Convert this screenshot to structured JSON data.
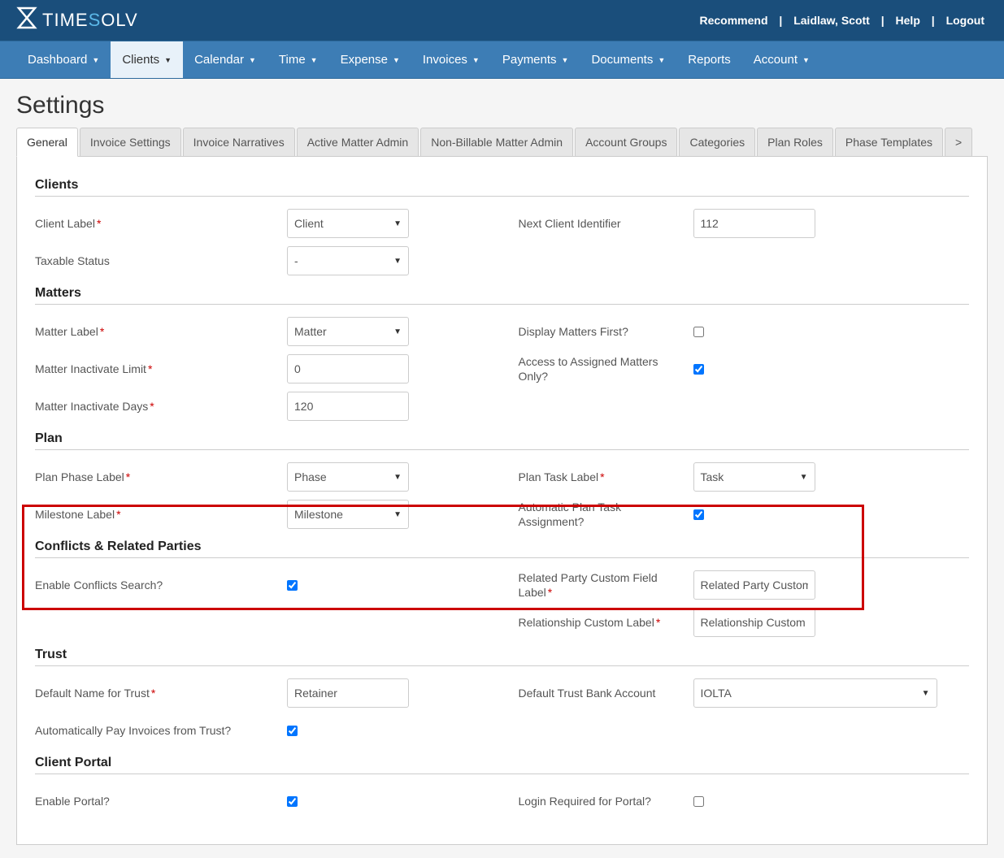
{
  "brand": {
    "t1": "T",
    "rest1": "IME",
    "s": "S",
    "rest2": "OLV"
  },
  "topLinks": {
    "recommend": "Recommend",
    "user": "Laidlaw, Scott",
    "help": "Help",
    "logout": "Logout"
  },
  "nav": {
    "dashboard": "Dashboard",
    "clients": "Clients",
    "calendar": "Calendar",
    "time": "Time",
    "expense": "Expense",
    "invoices": "Invoices",
    "payments": "Payments",
    "documents": "Documents",
    "reports": "Reports",
    "account": "Account"
  },
  "pageTitle": "Settings",
  "tabs": {
    "general": "General",
    "invoiceSettings": "Invoice Settings",
    "invoiceNarratives": "Invoice Narratives",
    "activeMatterAdmin": "Active Matter Admin",
    "nonBillableMatterAdmin": "Non-Billable Matter Admin",
    "accountGroups": "Account Groups",
    "categories": "Categories",
    "planRoles": "Plan Roles",
    "phaseTemplates": "Phase Templates",
    "more": ">"
  },
  "sections": {
    "clients": "Clients",
    "matters": "Matters",
    "plan": "Plan",
    "conflicts": "Conflicts & Related Parties",
    "trust": "Trust",
    "clientPortal": "Client Portal"
  },
  "labels": {
    "clientLabel": "Client Label",
    "nextClientId": "Next Client Identifier",
    "taxableStatus": "Taxable Status",
    "matterLabel": "Matter Label",
    "displayMattersFirst": "Display Matters First?",
    "matterInactivateLimit": "Matter Inactivate Limit",
    "accessAssigned": "Access to Assigned Matters Only?",
    "matterInactivateDays": "Matter Inactivate Days",
    "planPhaseLabel": "Plan Phase Label",
    "planTaskLabel": "Plan Task Label",
    "milestoneLabel": "Milestone Label",
    "autoPlanTask": "Automatic Plan Task Assignment?",
    "enableConflicts": "Enable Conflicts Search?",
    "relatedPartyCustom": "Related Party Custom Field Label",
    "relationshipCustom": "Relationship Custom Label",
    "defaultTrustName": "Default Name for Trust",
    "defaultTrustBank": "Default Trust Bank Account",
    "autoPayInvoices": "Automatically Pay Invoices from Trust?",
    "enablePortal": "Enable Portal?",
    "loginRequired": "Login Required for Portal?"
  },
  "values": {
    "clientLabel": "Client",
    "nextClientId": "112",
    "taxableStatus": "-",
    "matterLabel": "Matter",
    "matterInactivateLimit": "0",
    "matterInactivateDays": "120",
    "planPhaseLabel": "Phase",
    "planTaskLabel": "Task",
    "milestoneLabel": "Milestone",
    "relatedPartyCustom": "Related Party Custom",
    "relationshipCustom": "Relationship Custom",
    "defaultTrustName": "Retainer",
    "defaultTrustBank": "IOLTA"
  },
  "checks": {
    "displayMattersFirst": false,
    "accessAssigned": true,
    "autoPlanTask": true,
    "enableConflicts": true,
    "autoPayInvoices": true,
    "enablePortal": true,
    "loginRequired": false
  }
}
